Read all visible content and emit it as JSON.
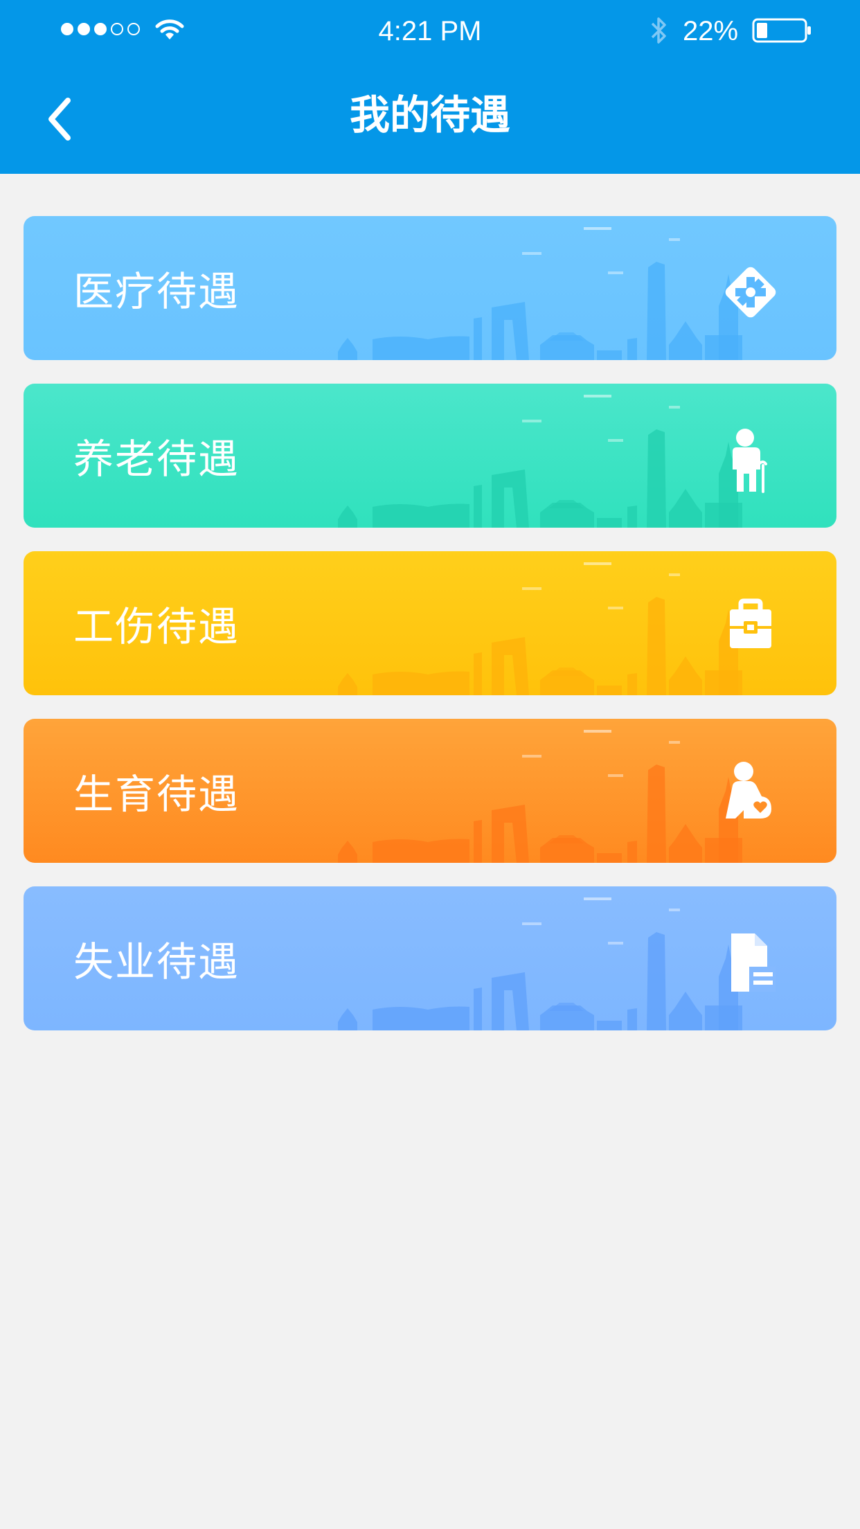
{
  "status_bar": {
    "time": "4:21 PM",
    "battery_percent": "22%",
    "signal_strength": 3,
    "signal_max": 5,
    "battery_level": 0.22,
    "icons": [
      "signal-dots-icon",
      "wifi-icon",
      "bluetooth-icon",
      "battery-icon"
    ]
  },
  "nav": {
    "title": "我的待遇",
    "back_icon": "chevron-left-icon"
  },
  "cards": [
    {
      "label": "医疗待遇",
      "icon": "medical-icon",
      "color": "#6fc6ff",
      "shade": "#4ab0fb"
    },
    {
      "label": "养老待遇",
      "icon": "elderly-icon",
      "color": "#3fe4c5",
      "shade": "#22cfae"
    },
    {
      "label": "工伤待遇",
      "icon": "first-aid-kit-icon",
      "color": "#ffca14",
      "shade": "#ffb20a"
    },
    {
      "label": "生育待遇",
      "icon": "pregnant-woman-icon",
      "color": "#ff9a2e",
      "shade": "#ff7818"
    },
    {
      "label": "失业待遇",
      "icon": "document-icon",
      "color": "#84b9ff",
      "shade": "#5fa0fb"
    }
  ],
  "colors": {
    "header": "#0497e8",
    "background": "#f2f2f2"
  }
}
